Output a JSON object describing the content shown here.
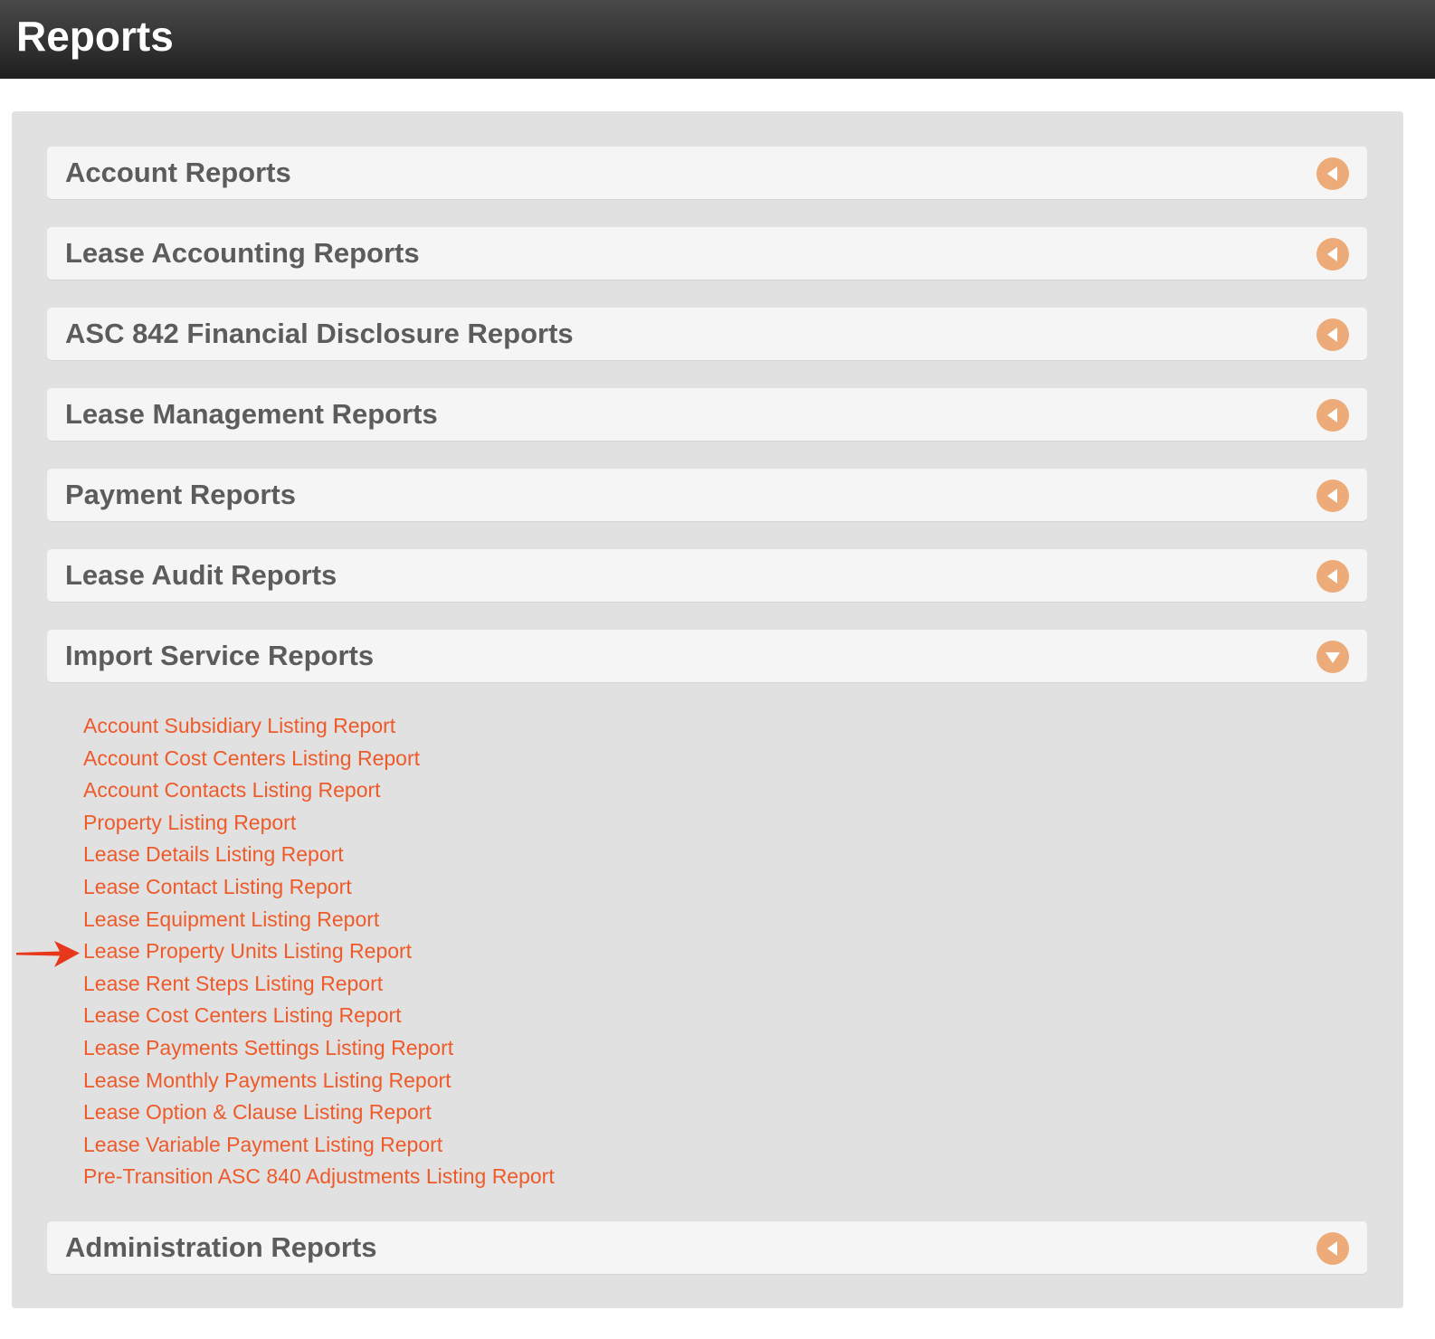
{
  "header": {
    "title": "Reports"
  },
  "sections": [
    {
      "title": "Account Reports",
      "state": "collapsed",
      "toggle_icon": "caret-left-icon"
    },
    {
      "title": "Lease Accounting Reports",
      "state": "collapsed",
      "toggle_icon": "caret-left-icon"
    },
    {
      "title": "ASC 842 Financial Disclosure Reports",
      "state": "collapsed",
      "toggle_icon": "caret-left-icon"
    },
    {
      "title": "Lease Management Reports",
      "state": "collapsed",
      "toggle_icon": "caret-left-icon"
    },
    {
      "title": "Payment Reports",
      "state": "collapsed",
      "toggle_icon": "caret-left-icon"
    },
    {
      "title": "Lease Audit Reports",
      "state": "collapsed",
      "toggle_icon": "caret-left-icon"
    },
    {
      "title": "Import Service Reports",
      "state": "expanded",
      "toggle_icon": "caret-down-icon"
    },
    {
      "title": "Administration Reports",
      "state": "collapsed",
      "toggle_icon": "caret-left-icon"
    }
  ],
  "import_service_reports": [
    "Account Subsidiary Listing Report",
    "Account Cost Centers Listing Report",
    "Account Contacts Listing Report",
    "Property Listing Report",
    "Lease Details Listing Report",
    "Lease Contact Listing Report",
    "Lease Equipment Listing Report",
    "Lease Property Units Listing Report",
    "Lease Rent Steps Listing Report",
    "Lease Cost Centers Listing Report",
    "Lease Payments Settings Listing Report",
    "Lease Monthly Payments Listing Report",
    "Lease Option & Clause Listing Report",
    "Lease Variable Payment Listing Report",
    "Pre-Transition ASC 840 Adjustments Listing Report"
  ],
  "annotation": {
    "icon": "red-arrow-icon",
    "points_to": "Lease Property Units Listing Report"
  },
  "colors": {
    "header_bg": "#2b2b2b",
    "panel_bg": "#e1e1e1",
    "section_bg": "#f5f5f5",
    "section_text": "#5c5c5c",
    "toggle_bg": "#ecab78",
    "link": "#ee5a2a",
    "arrow": "#e8381c"
  }
}
